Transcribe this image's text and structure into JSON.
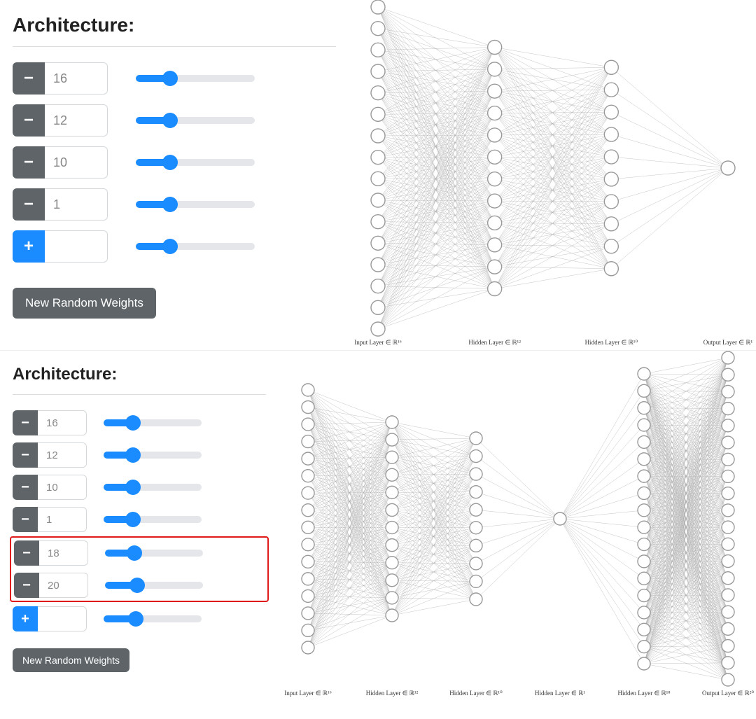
{
  "top": {
    "title": "Architecture:",
    "rows": [
      {
        "kind": "minus",
        "value": "16",
        "slider": 26
      },
      {
        "kind": "minus",
        "value": "12",
        "slider": 26
      },
      {
        "kind": "minus",
        "value": "10",
        "slider": 26
      },
      {
        "kind": "minus",
        "value": "1",
        "slider": 26
      },
      {
        "kind": "plus",
        "value": "",
        "slider": 26
      }
    ],
    "button": "New Random Weights",
    "network": {
      "layers": [
        16,
        12,
        10,
        1
      ],
      "labels": [
        "Input Layer ∈ ℝ¹⁶",
        "Hidden Layer ∈ ℝ¹²",
        "Hidden Layer ∈ ℝ¹⁰",
        "Output Layer ∈ ℝ¹"
      ]
    }
  },
  "bottom": {
    "title": "Architecture:",
    "rows": [
      {
        "kind": "minus",
        "value": "16",
        "slider": 26,
        "hl": false
      },
      {
        "kind": "minus",
        "value": "12",
        "slider": 26,
        "hl": false
      },
      {
        "kind": "minus",
        "value": "10",
        "slider": 26,
        "hl": false
      },
      {
        "kind": "minus",
        "value": "1",
        "slider": 26,
        "hl": false
      },
      {
        "kind": "minus",
        "value": "18",
        "slider": 26,
        "hl": true
      },
      {
        "kind": "minus",
        "value": "20",
        "slider": 30,
        "hl": true
      },
      {
        "kind": "plus",
        "value": "",
        "slider": 30,
        "hl": false
      }
    ],
    "button": "New Random Weights",
    "network": {
      "layers": [
        16,
        12,
        10,
        1,
        18,
        20
      ],
      "labels": [
        "Input Layer ∈ ℝ¹⁶",
        "Hidden Layer ∈ ℝ¹²",
        "Hidden Layer ∈ ℝ¹⁰",
        "Hidden Layer ∈ ℝ¹",
        "Hidden Layer ∈ ℝ¹⁸",
        "Output Layer ∈ ℝ²⁰"
      ]
    }
  },
  "icons": {
    "minus": "−",
    "plus": "+"
  }
}
